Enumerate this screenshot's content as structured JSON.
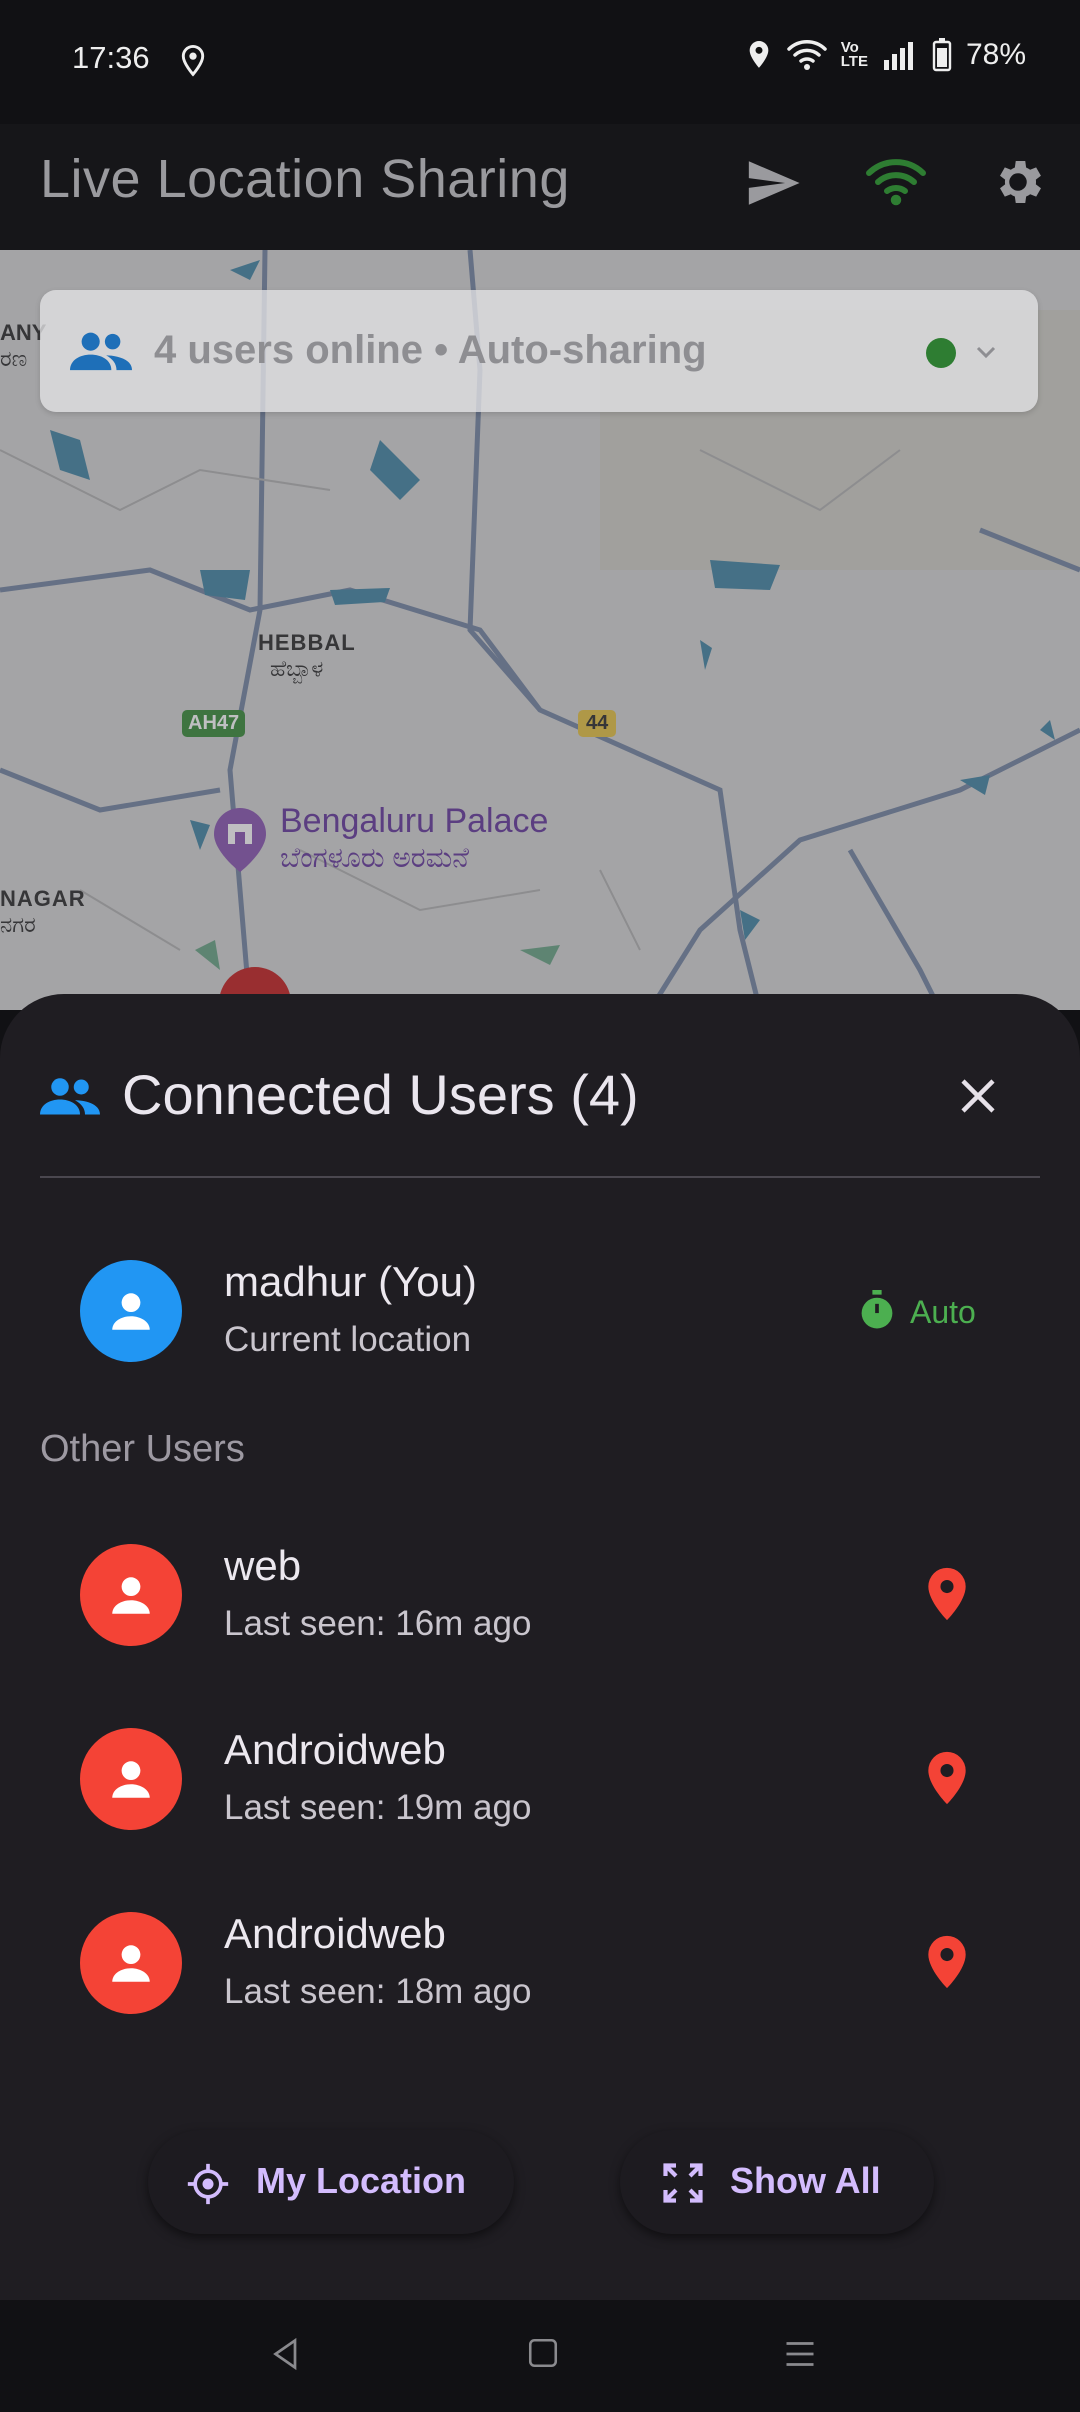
{
  "status_bar": {
    "time": "17:36",
    "battery": "78%"
  },
  "app_bar": {
    "title": "Live Location Sharing",
    "icons": [
      "send-icon",
      "wifi-icon",
      "settings-icon"
    ],
    "wifi_color": "#2e7d32"
  },
  "map": {
    "info_card": {
      "text": "4 users online • Auto-sharing",
      "status_color": "#2e7d32"
    },
    "labels": {
      "hebbal_en": "HEBBAL",
      "hebbal_kn": "ಹೆಬ್ಬಾಳ",
      "ah47": "AH47",
      "nh44": "44",
      "palace_en": "Bengaluru Palace",
      "palace_kn": "ಬೆಂಗಳೂರು ಅರಮನೆ",
      "nagar_en": "NAGAR",
      "nagar_kn": "ನಗರ",
      "any": "ANY",
      "any_kn": "ರಣ"
    }
  },
  "sheet": {
    "title": "Connected Users (4)",
    "current_user": {
      "name": "madhur (You)",
      "subtitle": "Current location",
      "badge": "Auto",
      "avatar_color": "#2196f3"
    },
    "other_users_label": "Other Users",
    "other_users": [
      {
        "name": "web",
        "subtitle": "Last seen: 16m ago"
      },
      {
        "name": "Androidweb",
        "subtitle": "Last seen: 19m ago"
      },
      {
        "name": "Androidweb",
        "subtitle": "Last seen: 18m ago"
      }
    ],
    "other_avatar_color": "#f44336",
    "buttons": {
      "my_location": "My Location",
      "show_all": "Show All"
    },
    "accent_color": "#d3bcfd"
  },
  "nav_bar": {
    "icons": [
      "back-icon",
      "home-icon",
      "menu-icon"
    ]
  }
}
